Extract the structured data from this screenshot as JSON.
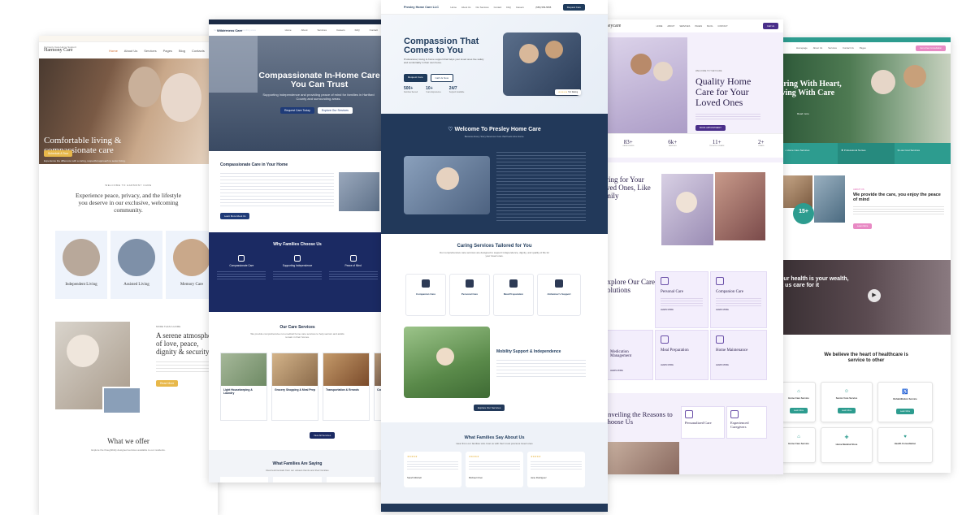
{
  "colors": {
    "navy": "#1f3b5c",
    "teal": "#2d9c8f",
    "purple": "#5b3fa0",
    "pink": "#e88ac4",
    "gold": "#e8b84a"
  },
  "p1": {
    "topbar": "Harmony Care Home Support",
    "logo": "Harmony Care",
    "nav": [
      "Home",
      "About Us",
      "Services",
      "Pages",
      "Blog",
      "Contacts"
    ],
    "hero_title": "Comfortable living & compassionate care",
    "hero_sub": "Experience the difference with a caring, respectful approach to senior living.",
    "hero_btn": "Schedule A Tour",
    "welcome_kicker": "WELCOME TO HARMONY CARE",
    "welcome": "Experience peace, privacy, and the lifestyle you deserve in our exclusive, welcoming community.",
    "cards": [
      "Independent Living",
      "Assisted Living",
      "Memory Care"
    ],
    "about_kicker": "MORE THAN A HOME",
    "about_title": "A serene atmosphere of love, peace, dignity & security",
    "about_btn": "Read More",
    "offer_title": "What we offer",
    "offer_sub": "Explore the thoughtfully designed services available to our residents."
  },
  "p2": {
    "topbar": "Serving Hartford County & surrounding areas",
    "logo": "Wilderness Care",
    "nav": [
      "Home",
      "About",
      "Services",
      "Careers",
      "FAQ",
      "Contact"
    ],
    "hero_title": "Compassionate In-Home Care You Can Trust",
    "hero_sub": "Supporting independence and providing peace of mind for families in Hartford County and surrounding areas.",
    "btn1": "Request Care Today",
    "btn2": "Explore Our Services",
    "sec_title": "Compassionate Care in Your Home",
    "sec_btn": "Learn More About Us",
    "why_title": "Why Families Choose Us",
    "why_items": [
      "Compassionate Care",
      "Supporting Independence",
      "Peace of Mind"
    ],
    "svc_title": "Our Care Services",
    "svc_sub": "We provide comprehensive non-medical home care services to help seniors and adults remain in their homes.",
    "svc_items": [
      "Light Housekeeping & Laundry",
      "Grocery Shopping & Meal Prep",
      "Transportation & Errands",
      "Comp"
    ],
    "all_btn": "View All Services",
    "say_title": "What Families Are Saying",
    "say_sub": "Real testimonials from our valued clients and their families"
  },
  "p3": {
    "logo": "Presley Home Care LLC",
    "nav": [
      "Home",
      "About Us",
      "Our Services",
      "Contact",
      "FAQ",
      "Careers"
    ],
    "phone": "(555) 555-5555",
    "nav_btn": "Request Care",
    "hero_title": "Compassion That Comes to You",
    "hero_sub": "Professional, loving in-home support that helps your loved ones live safely and comfortably in their own home.",
    "hero_btn1": "Request Care",
    "hero_btn2": "Call Us Now",
    "stats": [
      {
        "n": "500+",
        "l": "Families Served"
      },
      {
        "n": "10+",
        "l": "Years Experience"
      },
      {
        "n": "24/7",
        "l": "Support Available"
      }
    ],
    "badge": "5.0 Rating",
    "welcome_title": "Welcome To Presley Home Care",
    "welcome_sub": "Because Every Story Deserves Care that Feels Like Home.",
    "svc_title": "Caring Services Tailored for You",
    "svc_sub": "Our comprehensive care services are designed to support independence, dignity, and quality of life for your loved ones.",
    "svc_items": [
      "Companion Care",
      "Personal Care",
      "Meal Preparation",
      "Alzheimer's Support"
    ],
    "mob_title": "Mobility Support & Independence",
    "mob_btn": "Explore Our Services",
    "say_title": "What Families Say About Us",
    "say_sub": "Hear from our families who trust us with their most precious loved ones",
    "reviews": [
      "Sarah Mitchell",
      "Michael Chen",
      "Jane Rodriguez"
    ]
  },
  "p4": {
    "logo": "theycare",
    "nav": [
      "HOME",
      "ABOUT",
      "SERVICES",
      "PAGES",
      "BLOG",
      "CONTACT"
    ],
    "nav_btn": "Call Us",
    "kicker": "WELCOME TO THEYCARE",
    "hero_title": "Quality Home Care for Your Loved Ones",
    "hero_btn": "BOOK APPOINTMENT",
    "stats": [
      {
        "n": "83+",
        "l": "CAREGIVERS"
      },
      {
        "n": "6k+",
        "l": "FAMILIES"
      },
      {
        "n": "11+",
        "l": "TRUSTED YEARS"
      },
      {
        "n": "2+",
        "l": "YEARS"
      }
    ],
    "care_title": "Caring for Your Loved Ones, Like Family",
    "sol_title": "Explore Our Care Solutions",
    "sol_items": [
      "Personal Care",
      "Companion Care",
      "Medication Management",
      "Meal Preparation",
      "Home Maintenance"
    ],
    "read": "LEARN MORE",
    "reasons_title": "Unveiling the Reasons to Choose Us",
    "reasons_items": [
      "Personalized Care",
      "Experienced Caregivers"
    ]
  },
  "p5": {
    "nav": [
      "Homepage",
      "About Us",
      "Services",
      "Contact Us",
      "Pages"
    ],
    "nav_btn": "Get a free Consultation",
    "hero_title": "Caring With Heart, Living With Care",
    "hero_btn": "Read more",
    "strip": [
      "Home Care Services",
      "Professional Nurses",
      "Low Cost Services"
    ],
    "badge": "15+",
    "about_kicker": "ABOUT US",
    "about_title": "We provide the care, you enjoy the peace of mind",
    "about_btn": "Learn More",
    "video_title": "Your health is your wealth, let us care for it",
    "belief_title": "We believe the heart of healthcare is service to other",
    "svc_items": [
      "Home Care Service",
      "Senior Care Service",
      "Rehabilitation Service",
      "Home Care Service",
      "Home Medical Store",
      "Health Consultation"
    ],
    "svc_btn": "Learn More"
  }
}
